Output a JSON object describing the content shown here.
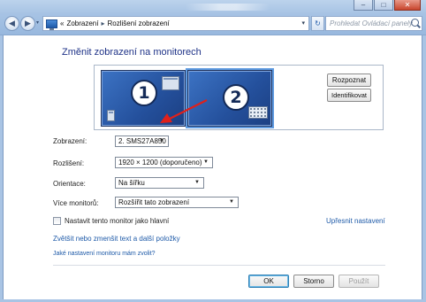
{
  "window": {
    "caption_buttons": {
      "minimize": "–",
      "maximize": "□",
      "close": "✕"
    }
  },
  "address_bar": {
    "prefix": "«",
    "breadcrumb": [
      "Zobrazení",
      "Rozlišení zobrazení"
    ],
    "separator": "▸",
    "dropdown": "▾",
    "refresh": "↻"
  },
  "search": {
    "placeholder": "Prohledat Ovládací panely"
  },
  "page": {
    "title": "Změnit zobrazení na monitorech"
  },
  "monitors": [
    {
      "number": "1",
      "selected": false
    },
    {
      "number": "2",
      "selected": true
    }
  ],
  "buttons": {
    "detect": "Rozpoznat",
    "identify": "Identifikovat",
    "ok": "OK",
    "cancel": "Storno",
    "apply": "Použít"
  },
  "form": {
    "display": {
      "label": "Zobrazení:",
      "value": "2. SMS27A850"
    },
    "resolution": {
      "label": "Rozlišení:",
      "value": "1920 × 1200 (doporučeno)"
    },
    "orientation": {
      "label": "Orientace:",
      "value": "Na šířku"
    },
    "multiple_displays": {
      "label": "Více monitorů:",
      "value": "Rozšířit tato zobrazení"
    }
  },
  "checkbox": {
    "label": "Nastavit tento monitor jako hlavní",
    "checked": false
  },
  "links": {
    "advanced": "Upřesnit nastavení",
    "text_size": "Zvětšit nebo zmenšit text a další položky",
    "which_settings": "Jaké nastavení monitoru mám zvolit?"
  },
  "colors": {
    "accent_link": "#1e5aa8",
    "title": "#1e3287",
    "monitor_fill": "#24509c",
    "arrow": "#e0201a"
  }
}
